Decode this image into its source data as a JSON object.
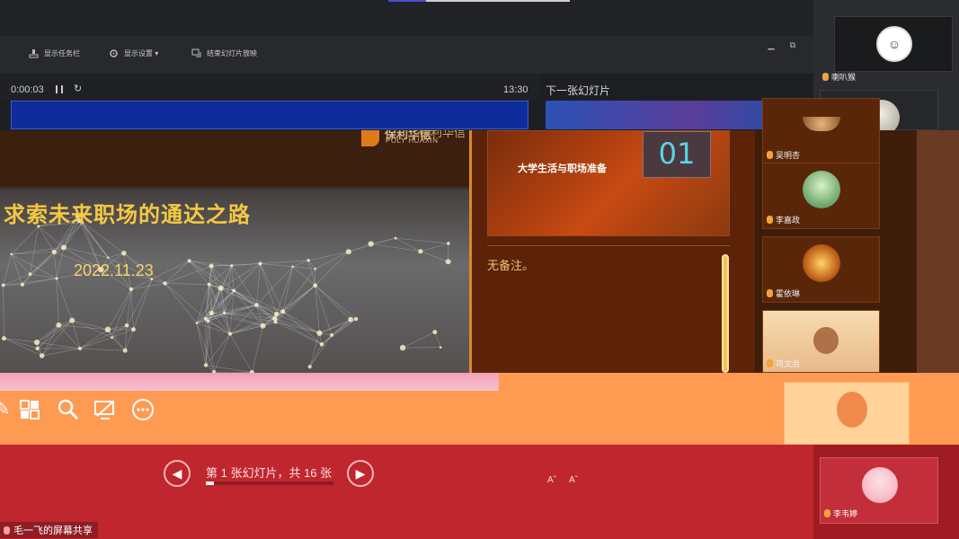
{
  "toolbar": {
    "show_taskbar": "显示任务栏",
    "display_settings": "显示设置 ▾",
    "end_slideshow": "结束幻灯片放映",
    "minimize": "▁",
    "restore": "⧉",
    "close": "✕"
  },
  "presenter": {
    "elapsed": "0:00:03",
    "clock": "13:30",
    "next_slide_label": "下一张幻灯片",
    "progress_fraction": 0.0625
  },
  "slide": {
    "logo_cn": "保利华信",
    "logo_en": "POLY HUAXIN",
    "logo_cn_2": "保利华信",
    "title": "求索未来职场的通达之路",
    "date": "2022.11.23"
  },
  "next_slide": {
    "title": "大学生活与职场准备",
    "number": "01"
  },
  "notes": {
    "text": "无备注。"
  },
  "participants": {
    "self_name": "喇叭猴",
    "tiles": [
      {
        "name": "吴明杏"
      },
      {
        "name": "李嘉政"
      },
      {
        "name": "霍依琳"
      },
      {
        "name": "司文治"
      }
    ],
    "bottom_name": "李韦婷"
  },
  "navigation": {
    "prev_icon": "◀",
    "next_icon": "▶",
    "counter": "第 1 张幻灯片，共 16 张"
  },
  "font_controls": {
    "increase": "Aˆ",
    "decrease": "Aˇ"
  },
  "share": {
    "label": "毛一飞的屏幕共享"
  },
  "colors": {
    "title_gold": "#f5c842",
    "orange_band": "#ff9a52",
    "red_band": "#c0262e"
  }
}
